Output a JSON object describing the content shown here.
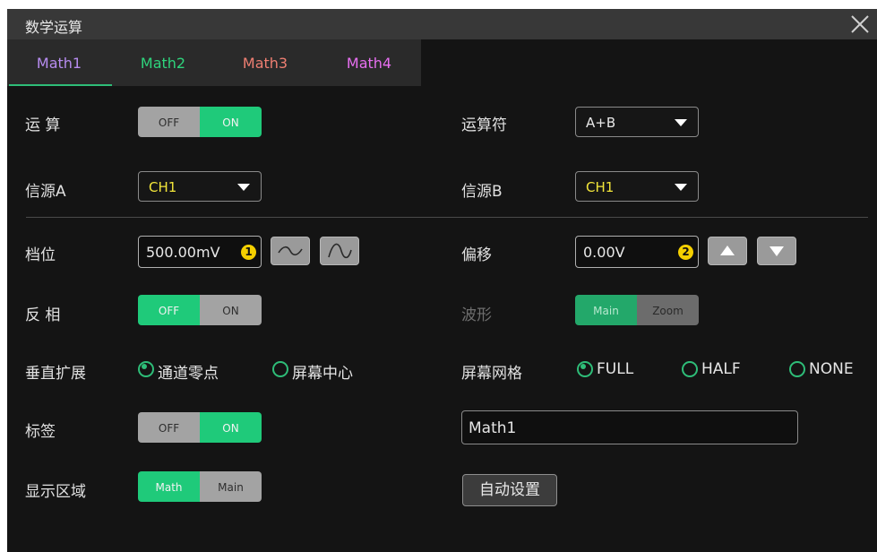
{
  "window": {
    "title": "数学运算",
    "close_icon": "close-icon"
  },
  "tabs": [
    {
      "label": "Math1",
      "color": "#b78cf0"
    },
    {
      "label": "Math2",
      "color": "#2ed47c"
    },
    {
      "label": "Math3",
      "color": "#ef7f72"
    },
    {
      "label": "Math4",
      "color": "#e76ff0"
    }
  ],
  "active_tab": "Math1",
  "operation": {
    "label": "运 算",
    "off": "OFF",
    "on": "ON",
    "state": "ON"
  },
  "operator": {
    "label": "运算符",
    "value": "A+B"
  },
  "source_a": {
    "label": "信源A",
    "value": "CH1",
    "value_color": "#f3e63a"
  },
  "source_b": {
    "label": "信源B",
    "value": "CH1",
    "value_color": "#f3e63a"
  },
  "scale": {
    "label": "档位",
    "value": "500.00mV",
    "knob": "1",
    "buttons": [
      "coarse-wave-icon",
      "fine-wave-icon"
    ]
  },
  "offset": {
    "label": "偏移",
    "value": "0.00V",
    "knob": "2",
    "buttons": [
      "triangle-up-icon",
      "triangle-down-icon"
    ]
  },
  "invert": {
    "label": "反 相",
    "off": "OFF",
    "on": "ON",
    "state": "OFF"
  },
  "waveform": {
    "label": "波形",
    "opt1": "Main",
    "opt2": "Zoom",
    "selected": "Main"
  },
  "vertical_expand": {
    "label": "垂直扩展",
    "options": [
      "通道零点",
      "屏幕中心"
    ],
    "selected": "通道零点"
  },
  "screen_grid": {
    "label": "屏幕网格",
    "options": [
      "FULL",
      "HALF",
      "NONE"
    ],
    "selected": "FULL"
  },
  "tag": {
    "label": "标签",
    "off": "OFF",
    "on": "ON",
    "state": "ON",
    "text": "Math1"
  },
  "display_area": {
    "label": "显示区域",
    "opt1": "Math",
    "opt2": "Main",
    "selected": "Math"
  },
  "auto_setup": {
    "label": "自动设置"
  },
  "colors": {
    "accent": "#1fca7a",
    "panel_bg": "#141414",
    "title_bg": "#383838"
  }
}
